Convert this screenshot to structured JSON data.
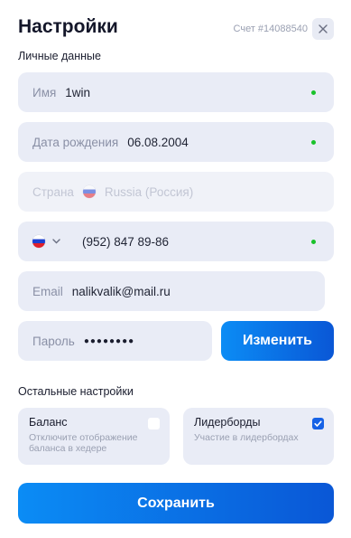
{
  "header": {
    "title": "Настройки",
    "account": "Счет #14088540"
  },
  "personal": {
    "section_label": "Личные данные",
    "name": {
      "label": "Имя",
      "value": "1win",
      "verified": true
    },
    "birthdate": {
      "label": "Дата рождения",
      "value": "06.08.2004",
      "verified": true
    },
    "country": {
      "label": "Страна",
      "value": "Russia (Россия)",
      "flag_icon": "russia-flag-icon"
    },
    "phone": {
      "value": "(952) 847 89-86",
      "flag_icon": "russia-flag-icon",
      "verified": true
    },
    "email": {
      "label": "Email",
      "value": "nalikvalik@mail.ru"
    },
    "password": {
      "label": "Пароль",
      "value": "●●●●●●●●"
    },
    "change_button": "Изменить"
  },
  "other": {
    "section_label": "Остальные настройки",
    "balance": {
      "title": "Баланс",
      "subtitle": "Отключите отображение баланса в хедере",
      "checked": false
    },
    "leaderboards": {
      "title": "Лидерборды",
      "subtitle": "Участие в лидербордах",
      "checked": true
    }
  },
  "save_button": "Сохранить",
  "colors": {
    "accent": "#0a6fe8",
    "field_bg": "#e9ecf6",
    "verified_dot": "#19c22a"
  }
}
